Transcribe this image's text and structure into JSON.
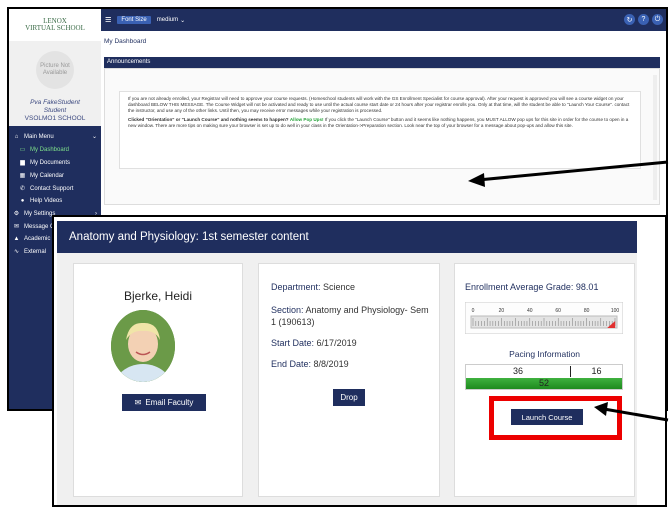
{
  "logo": {
    "line1": "LENOX",
    "line2": "VIRTUAL SCHOOL"
  },
  "sidebar": {
    "photo_text": "Picture Not Available",
    "user_name": "Pva FakeStudent",
    "user_role": "Student",
    "school": "VSOLMO1 SCHOOL",
    "items": [
      {
        "label": "Main Menu",
        "icon": "home-icon",
        "arrow": "⌄"
      },
      {
        "label": "My Dashboard",
        "icon": "desktop-icon"
      },
      {
        "label": "My Documents",
        "icon": "document-icon"
      },
      {
        "label": "My Calendar",
        "icon": "calendar-icon"
      },
      {
        "label": "Contact Support",
        "icon": "phone-icon"
      },
      {
        "label": "Help Videos",
        "icon": "help-icon"
      },
      {
        "label": "My Settings",
        "icon": "settings-icon",
        "arrow": "›"
      },
      {
        "label": "Message Center",
        "icon": "message-icon",
        "arrow": "›"
      },
      {
        "label": "Academic Info",
        "icon": "graduation-icon",
        "arrow": "›"
      },
      {
        "label": "External",
        "icon": "link-icon"
      }
    ]
  },
  "topbar": {
    "font_size_label": "Font Size",
    "font_size_value": "medium"
  },
  "breadcrumb": "My Dashboard",
  "announcements": {
    "title": "Announcements",
    "p1": "If you are not already enrolled, your Registrar will need to approve your course requests. (Homeschool students will work with the GS Enrollment Specialist for course approval). After your request is approved you will see a course widget on your dashboard BELOW THIS MESSAGE. The Course Widget will not be activated and ready to use until the actual course start date or 24 hours after your registrar enrolls you. Only at that time, will the student be able to \"Launch Your Course\". contact the instructor, and use any of the other links. Until then, you may receive error messages while your registration is processed.",
    "p2_bold": "Clicked \"Orientation\" or \"Launch Course\" and nothing seems to happen?",
    "p2_green": "Allow Pop Ups!",
    "p2_rest": "If you click the \"Launch Course\" button and it seems like nothing happens, you MUST ALLOW pop ups for this site in order for the course to open in a new window. There are more tips on making sure your browser is set up to do well in your class in the Orientation->Preparation section. Look near the top of your browser for a message about pop-ups and allow this site."
  },
  "course": {
    "title": "Anatomy and Physiology: 1st semester content",
    "faculty": "Bjerke, Heidi",
    "email_label": "Email Faculty",
    "department_label": "Department:",
    "department": "Science",
    "section_label": "Section:",
    "section": "Anatomy and Physiology- Sem 1 (190613)",
    "start_label": "Start Date:",
    "start_date": "6/17/2019",
    "end_label": "End Date:",
    "end_date": "8/8/2019",
    "drop_label": "Drop",
    "grade_label": "Enrollment Average Grade:",
    "grade": "98.01",
    "gauge_ticks": [
      "0",
      "20",
      "40",
      "60",
      "80",
      "100"
    ],
    "gauge_value": 98.01,
    "pacing_label": "Pacing Information",
    "pacing_left": "36",
    "pacing_right": "16",
    "pacing_bar": "52",
    "launch_label": "Launch Course"
  },
  "colors": {
    "navy": "#1f2e5e",
    "accent_green": "#27a33b",
    "highlight_red": "#ec0000"
  }
}
